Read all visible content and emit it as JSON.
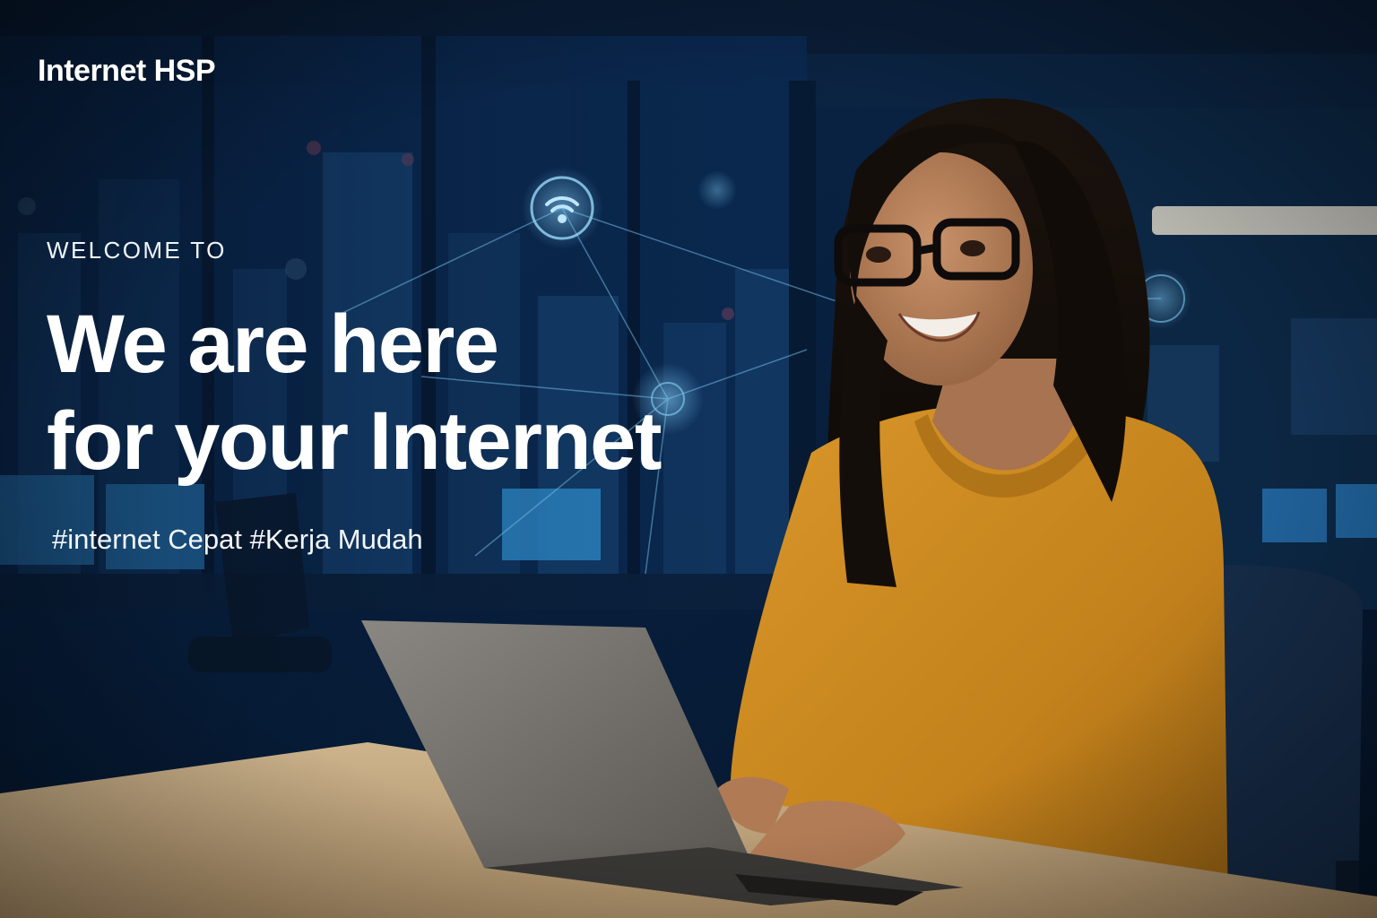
{
  "brand": {
    "name": "Internet HSP"
  },
  "hero": {
    "eyebrow": "WELCOME TO",
    "headline_line1": "We are here",
    "headline_line2": "for your Internet",
    "tagline": "#internet Cepat #Kerja Mudah"
  },
  "background": {
    "icons": [
      "wifi-icon",
      "network-node-icon"
    ],
    "colors": {
      "night_blue": "#0a2447",
      "sweater_mustard": "#c9871f",
      "desk_beige": "#c9ad86",
      "laptop_grey": "#6e6c68",
      "glow_cyan": "#6fb6e0"
    }
  }
}
